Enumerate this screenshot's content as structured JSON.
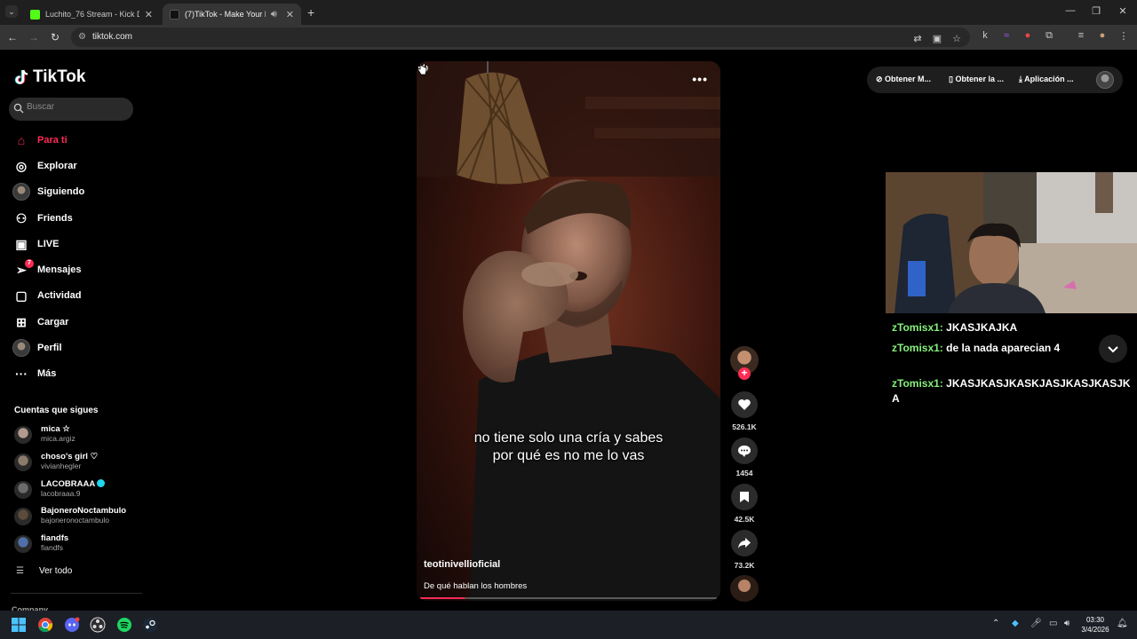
{
  "browser": {
    "tabs": [
      {
        "title": "Luchito_76 Stream - Kick Dashb",
        "favicon_color": "#53fc18"
      },
      {
        "title": "(7)TikTok - Make Your Day",
        "favicon_color": "#111111"
      }
    ],
    "url": "tiktok.com"
  },
  "tiktok": {
    "logo_text": "TikTok",
    "search_placeholder": "Buscar",
    "nav": [
      {
        "label": "Para ti",
        "icon": "home-icon",
        "active": true
      },
      {
        "label": "Explorar",
        "icon": "compass-icon"
      },
      {
        "label": "Siguiendo",
        "icon": "following-avatar-icon"
      },
      {
        "label": "Friends",
        "icon": "friends-icon"
      },
      {
        "label": "LIVE",
        "icon": "live-icon"
      },
      {
        "label": "Mensajes",
        "icon": "messages-icon",
        "badge": "7"
      },
      {
        "label": "Actividad",
        "icon": "activity-icon"
      },
      {
        "label": "Cargar",
        "icon": "upload-icon"
      },
      {
        "label": "Perfil",
        "icon": "profile-avatar-icon"
      },
      {
        "label": "Más",
        "icon": "more-icon"
      }
    ],
    "following_heading": "Cuentas que sigues",
    "following": [
      {
        "name": "mica ☆",
        "handle": "mica.argiz"
      },
      {
        "name": "choso's girl ♡",
        "handle": "vivianhegler"
      },
      {
        "name": "LACOBRAAA",
        "handle": "lacobraaa.9",
        "verified": true
      },
      {
        "name": "BajoneroNoctambulo",
        "handle": "bajoneronoctambulo"
      },
      {
        "name": "fiandfs",
        "handle": "fiandfs"
      }
    ],
    "see_all": "Ver todo",
    "company": "Company",
    "top_pill": [
      "Obtener M...",
      "Obtener la ...",
      "Aplicación ..."
    ],
    "video": {
      "caption_line1": "no tiene solo una cría y sabes",
      "caption_line2": "por qué es no me lo vas",
      "author": "teotinivellioficial",
      "description": "De qué hablan los hombres",
      "progress_percent": 15
    },
    "actions": {
      "likes": "526.1K",
      "comments": "1454",
      "saves": "42.5K",
      "shares": "73.2K"
    }
  },
  "stream_chat": [
    {
      "user": "zTomisx1:",
      "text": "JKASJKAJKA"
    },
    {
      "user": "zTomisx1:",
      "text": "de la nada aparecian 4"
    },
    {
      "user": "zTomisx1:",
      "text": "JKASJKASJKASKJASJKASJKASJKA"
    }
  ],
  "taskbar": {
    "time": "03:30",
    "date": "3/4/2026"
  },
  "colors": {
    "accent": "#fe2c55",
    "chat_username": "#86f07a"
  }
}
